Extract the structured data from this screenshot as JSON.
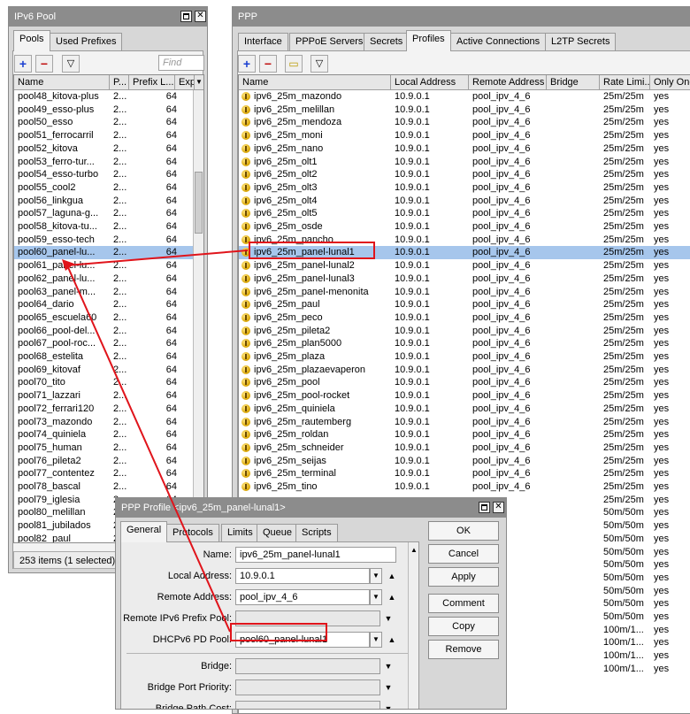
{
  "ipv6_pool_window": {
    "title": "IPv6 Pool",
    "tabs": [
      {
        "label": "Pools"
      },
      {
        "label": "Used Prefixes"
      }
    ],
    "toolbar": {
      "add": "+",
      "remove": "−",
      "filter": "▽",
      "find_placeholder": "Find"
    },
    "columns": [
      "Name",
      "P...",
      "Prefix L...",
      "Expi",
      "▼"
    ],
    "rows": [
      [
        "pool48_kitova-plus",
        "2...",
        "64"
      ],
      [
        "pool49_esso-plus",
        "2...",
        "64"
      ],
      [
        "pool50_esso",
        "2...",
        "64"
      ],
      [
        "pool51_ferrocarril",
        "2...",
        "64"
      ],
      [
        "pool52_kitova",
        "2...",
        "64"
      ],
      [
        "pool53_ferro-tur...",
        "2...",
        "64"
      ],
      [
        "pool54_esso-turbo",
        "2...",
        "64"
      ],
      [
        "pool55_cool2",
        "2...",
        "64"
      ],
      [
        "pool56_linkgua",
        "2...",
        "64"
      ],
      [
        "pool57_laguna-g...",
        "2...",
        "64"
      ],
      [
        "pool58_kitova-tu...",
        "2...",
        "64"
      ],
      [
        "pool59_esso-tech",
        "2...",
        "64"
      ],
      [
        "pool60_panel-lu...",
        "2...",
        "64"
      ],
      [
        "pool61_panel-lu...",
        "2...",
        "64"
      ],
      [
        "pool62_panel-lu...",
        "2...",
        "64"
      ],
      [
        "pool63_panel-m...",
        "2...",
        "64"
      ],
      [
        "pool64_dario",
        "2...",
        "64"
      ],
      [
        "pool65_escuela60",
        "2...",
        "64"
      ],
      [
        "pool66_pool-del...",
        "2...",
        "64"
      ],
      [
        "pool67_pool-roc...",
        "2...",
        "64"
      ],
      [
        "pool68_estelita",
        "2...",
        "64"
      ],
      [
        "pool69_kitovaf",
        "2...",
        "64"
      ],
      [
        "pool70_tito",
        "2...",
        "64"
      ],
      [
        "pool71_lazzari",
        "2...",
        "64"
      ],
      [
        "pool72_ferrari120",
        "2...",
        "64"
      ],
      [
        "pool73_mazondo",
        "2...",
        "64"
      ],
      [
        "pool74_quiniela",
        "2...",
        "64"
      ],
      [
        "pool75_human",
        "2...",
        "64"
      ],
      [
        "pool76_pileta2",
        "2...",
        "64"
      ],
      [
        "pool77_contentez",
        "2...",
        "64"
      ],
      [
        "pool78_bascal",
        "2...",
        "64"
      ],
      [
        "pool79_iglesia",
        "2...",
        "64"
      ],
      [
        "pool80_melillan",
        "2...",
        "64"
      ],
      [
        "pool81_jubilados",
        "2...",
        "64"
      ],
      [
        "pool82_paul",
        "2...",
        "64"
      ]
    ],
    "selected_index": 12,
    "status": "253 items (1 selected)"
  },
  "ppp_window": {
    "title": "PPP",
    "tabs": [
      {
        "label": "Interface"
      },
      {
        "label": "PPPoE Servers"
      },
      {
        "label": "Secrets"
      },
      {
        "label": "Profiles"
      },
      {
        "label": "Active Connections"
      },
      {
        "label": "L2TP Secrets"
      }
    ],
    "active_tab": 3,
    "toolbar": {
      "add": "+",
      "remove": "−",
      "comment": "▭",
      "filter": "▽"
    },
    "columns": [
      "Name",
      "Local Address",
      "Remote Address",
      "Bridge",
      "Rate Limi...",
      "Only One"
    ],
    "rows": [
      [
        "ipv6_25m_mazondo",
        "10.9.0.1",
        "pool_ipv_4_6",
        "",
        "25m/25m",
        "yes"
      ],
      [
        "ipv6_25m_melillan",
        "10.9.0.1",
        "pool_ipv_4_6",
        "",
        "25m/25m",
        "yes"
      ],
      [
        "ipv6_25m_mendoza",
        "10.9.0.1",
        "pool_ipv_4_6",
        "",
        "25m/25m",
        "yes"
      ],
      [
        "ipv6_25m_moni",
        "10.9.0.1",
        "pool_ipv_4_6",
        "",
        "25m/25m",
        "yes"
      ],
      [
        "ipv6_25m_nano",
        "10.9.0.1",
        "pool_ipv_4_6",
        "",
        "25m/25m",
        "yes"
      ],
      [
        "ipv6_25m_olt1",
        "10.9.0.1",
        "pool_ipv_4_6",
        "",
        "25m/25m",
        "yes"
      ],
      [
        "ipv6_25m_olt2",
        "10.9.0.1",
        "pool_ipv_4_6",
        "",
        "25m/25m",
        "yes"
      ],
      [
        "ipv6_25m_olt3",
        "10.9.0.1",
        "pool_ipv_4_6",
        "",
        "25m/25m",
        "yes"
      ],
      [
        "ipv6_25m_olt4",
        "10.9.0.1",
        "pool_ipv_4_6",
        "",
        "25m/25m",
        "yes"
      ],
      [
        "ipv6_25m_olt5",
        "10.9.0.1",
        "pool_ipv_4_6",
        "",
        "25m/25m",
        "yes"
      ],
      [
        "ipv6_25m_osde",
        "10.9.0.1",
        "pool_ipv_4_6",
        "",
        "25m/25m",
        "yes"
      ],
      [
        "ipv6_25m_pancho",
        "10.9.0.1",
        "pool_ipv_4_6",
        "",
        "25m/25m",
        "yes"
      ],
      [
        "ipv6_25m_panel-lunal1",
        "10.9.0.1",
        "pool_ipv_4_6",
        "",
        "25m/25m",
        "yes"
      ],
      [
        "ipv6_25m_panel-lunal2",
        "10.9.0.1",
        "pool_ipv_4_6",
        "",
        "25m/25m",
        "yes"
      ],
      [
        "ipv6_25m_panel-lunal3",
        "10.9.0.1",
        "pool_ipv_4_6",
        "",
        "25m/25m",
        "yes"
      ],
      [
        "ipv6_25m_panel-menonita",
        "10.9.0.1",
        "pool_ipv_4_6",
        "",
        "25m/25m",
        "yes"
      ],
      [
        "ipv6_25m_paul",
        "10.9.0.1",
        "pool_ipv_4_6",
        "",
        "25m/25m",
        "yes"
      ],
      [
        "ipv6_25m_peco",
        "10.9.0.1",
        "pool_ipv_4_6",
        "",
        "25m/25m",
        "yes"
      ],
      [
        "ipv6_25m_pileta2",
        "10.9.0.1",
        "pool_ipv_4_6",
        "",
        "25m/25m",
        "yes"
      ],
      [
        "ipv6_25m_plan5000",
        "10.9.0.1",
        "pool_ipv_4_6",
        "",
        "25m/25m",
        "yes"
      ],
      [
        "ipv6_25m_plaza",
        "10.9.0.1",
        "pool_ipv_4_6",
        "",
        "25m/25m",
        "yes"
      ],
      [
        "ipv6_25m_plazaevaperon",
        "10.9.0.1",
        "pool_ipv_4_6",
        "",
        "25m/25m",
        "yes"
      ],
      [
        "ipv6_25m_pool",
        "10.9.0.1",
        "pool_ipv_4_6",
        "",
        "25m/25m",
        "yes"
      ],
      [
        "ipv6_25m_pool-rocket",
        "10.9.0.1",
        "pool_ipv_4_6",
        "",
        "25m/25m",
        "yes"
      ],
      [
        "ipv6_25m_quiniela",
        "10.9.0.1",
        "pool_ipv_4_6",
        "",
        "25m/25m",
        "yes"
      ],
      [
        "ipv6_25m_rautemberg",
        "10.9.0.1",
        "pool_ipv_4_6",
        "",
        "25m/25m",
        "yes"
      ],
      [
        "ipv6_25m_roldan",
        "10.9.0.1",
        "pool_ipv_4_6",
        "",
        "25m/25m",
        "yes"
      ],
      [
        "ipv6_25m_schneider",
        "10.9.0.1",
        "pool_ipv_4_6",
        "",
        "25m/25m",
        "yes"
      ],
      [
        "ipv6_25m_seijas",
        "10.9.0.1",
        "pool_ipv_4_6",
        "",
        "25m/25m",
        "yes"
      ],
      [
        "ipv6_25m_terminal",
        "10.9.0.1",
        "pool_ipv_4_6",
        "",
        "25m/25m",
        "yes"
      ],
      [
        "ipv6_25m_tino",
        "10.9.0.1",
        "pool_ipv_4_6",
        "",
        "25m/25m",
        "yes"
      ],
      [
        "",
        "",
        "",
        "",
        "25m/25m",
        "yes"
      ],
      [
        "",
        "",
        "",
        "",
        "50m/50m",
        "yes"
      ],
      [
        "",
        "",
        "",
        "",
        "50m/50m",
        "yes"
      ],
      [
        "",
        "",
        "",
        "",
        "50m/50m",
        "yes"
      ],
      [
        "",
        "",
        "",
        "",
        "50m/50m",
        "yes"
      ],
      [
        "",
        "",
        "",
        "",
        "50m/50m",
        "yes"
      ],
      [
        "",
        "",
        "",
        "",
        "50m/50m",
        "yes"
      ],
      [
        "",
        "",
        "",
        "",
        "50m/50m",
        "yes"
      ],
      [
        "",
        "",
        "",
        "",
        "50m/50m",
        "yes"
      ],
      [
        "",
        "",
        "",
        "",
        "50m/50m",
        "yes"
      ],
      [
        "",
        "",
        "",
        "",
        "100m/1...",
        "yes"
      ],
      [
        "",
        "",
        "",
        "",
        "100m/1...",
        "yes"
      ],
      [
        "",
        "",
        "",
        "",
        "100m/1...",
        "yes"
      ],
      [
        "",
        "",
        "",
        "",
        "100m/1...",
        "yes"
      ]
    ],
    "selected_index": 12
  },
  "profile_dialog": {
    "title": "PPP Profile <ipv6_25m_panel-lunal1>",
    "tabs": [
      {
        "label": "General"
      },
      {
        "label": "Protocols"
      },
      {
        "label": "Limits"
      },
      {
        "label": "Queue"
      },
      {
        "label": "Scripts"
      }
    ],
    "fields": {
      "name_label": "Name:",
      "name_value": "ipv6_25m_panel-lunal1",
      "local_label": "Local Address:",
      "local_value": "10.9.0.1",
      "remote_label": "Remote Address:",
      "remote_value": "pool_ipv_4_6",
      "remote_ipv6_label": "Remote IPv6 Prefix Pool:",
      "remote_ipv6_value": "",
      "dhcpv6_label": "DHCPv6 PD Pool:",
      "dhcpv6_value": "pool60_panel-lunal1",
      "bridge_label": "Bridge:",
      "bridge_value": "",
      "bridge_port_priority_label": "Bridge Port Priority:",
      "bridge_port_priority_value": "",
      "bridge_path_cost_label": "Bridge Path Cost:",
      "bridge_path_cost_value": ""
    },
    "buttons": {
      "ok": "OK",
      "cancel": "Cancel",
      "apply": "Apply",
      "comment": "Comment",
      "copy": "Copy",
      "remove": "Remove"
    }
  },
  "annotation_color": "#e0141b"
}
